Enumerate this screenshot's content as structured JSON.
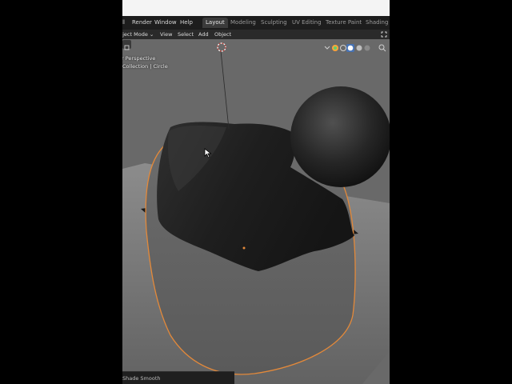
{
  "menubar": {
    "items": [
      "ll",
      "Render",
      "Window",
      "Help"
    ],
    "tabs": [
      "Layout",
      "Modeling",
      "Sculpting",
      "UV Editing",
      "Texture Paint",
      "Shading"
    ],
    "active_tab": "Layout"
  },
  "header": {
    "mode": "bject Mode",
    "menus": [
      "View",
      "Select",
      "Add",
      "Object"
    ]
  },
  "viewport": {
    "view_name": "r Perspective",
    "collection_label": "Collection | Circle"
  },
  "statusbar": {
    "last_operation": "Shade Smooth"
  },
  "colors": {
    "selection_outline": "#e3893a",
    "active_tab_bg": "#3b3b3b",
    "menubar_bg": "#1d1d1d"
  },
  "icons": [
    "view-toggle-icon",
    "camera-icon",
    "overlay-dropdown-icon",
    "shading-wireframe-icon",
    "shading-solid-icon",
    "shading-material-icon",
    "shading-rendered-icon",
    "search-icon",
    "maximize-icon",
    "mouse-cursor-icon",
    "3d-cursor-icon"
  ]
}
